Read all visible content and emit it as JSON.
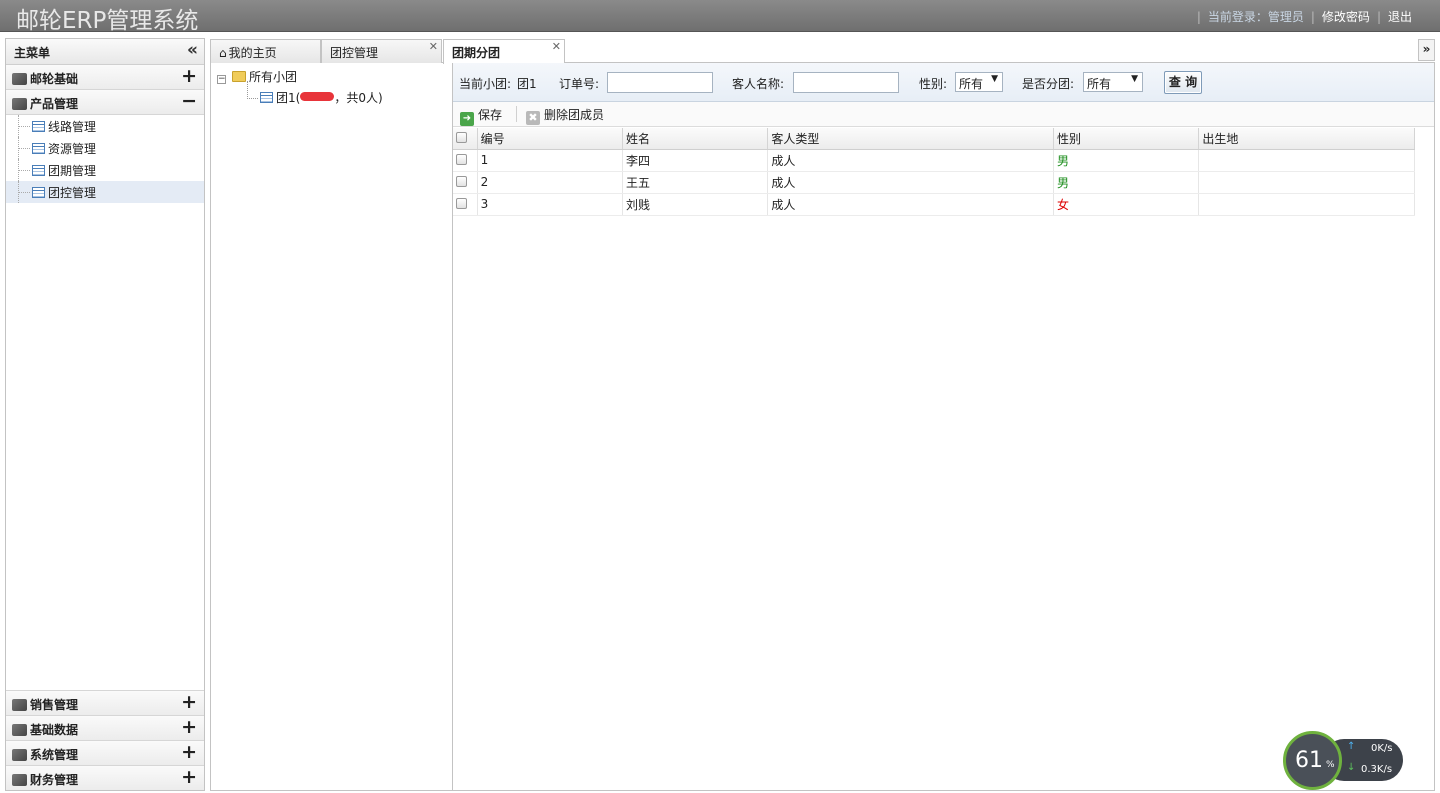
{
  "header": {
    "title": "邮轮ERP管理系统",
    "current_login": "当前登录：管理员",
    "change_password": "修改密码",
    "logout": "退出"
  },
  "menu": {
    "title": "主菜单",
    "sections": [
      {
        "label": "邮轮基础",
        "state": "+"
      },
      {
        "label": "产品管理",
        "state": "−"
      }
    ],
    "product_items": [
      "线路管理",
      "资源管理",
      "团期管理",
      "团控管理"
    ],
    "bottom_sections": [
      {
        "label": "销售管理",
        "state": "+"
      },
      {
        "label": "基础数据",
        "state": "+"
      },
      {
        "label": "系统管理",
        "state": "+"
      },
      {
        "label": "财务管理",
        "state": "+"
      }
    ]
  },
  "tabs": [
    {
      "label": "我的主页"
    },
    {
      "label": "团控管理"
    },
    {
      "label": "团期分团"
    }
  ],
  "tree": {
    "root": "所有小团",
    "child_prefix": "团1(",
    "child_suffix": "，共0人)"
  },
  "search": {
    "current_group_label": "当前小团:",
    "current_group_value": "团1",
    "order_no_label": "订单号:",
    "order_no_value": "",
    "guest_name_label": "客人名称:",
    "guest_name_value": "",
    "gender_label": "性别:",
    "gender_value": "所有",
    "grouped_label": "是否分团:",
    "grouped_value": "所有",
    "query_button": "查 询"
  },
  "toolbar": {
    "save": "保存",
    "delete_member": "删除团成员"
  },
  "table": {
    "columns": [
      "编号",
      "姓名",
      "客人类型",
      "性别",
      "出生地"
    ],
    "rows": [
      {
        "id": "1",
        "name": "李四",
        "type": "成人",
        "gender": "男",
        "birthplace": ""
      },
      {
        "id": "2",
        "name": "王五",
        "type": "成人",
        "gender": "男",
        "birthplace": ""
      },
      {
        "id": "3",
        "name": "刘贱",
        "type": "成人",
        "gender": "女",
        "birthplace": ""
      }
    ]
  },
  "widget": {
    "percent": "61",
    "percent_sign": "%",
    "upload": "0K/s",
    "download": "0.3K/s"
  },
  "colors": {
    "male": "#1a8c1a",
    "female": "#dd0000",
    "header_bg": "#7d7d7d"
  }
}
